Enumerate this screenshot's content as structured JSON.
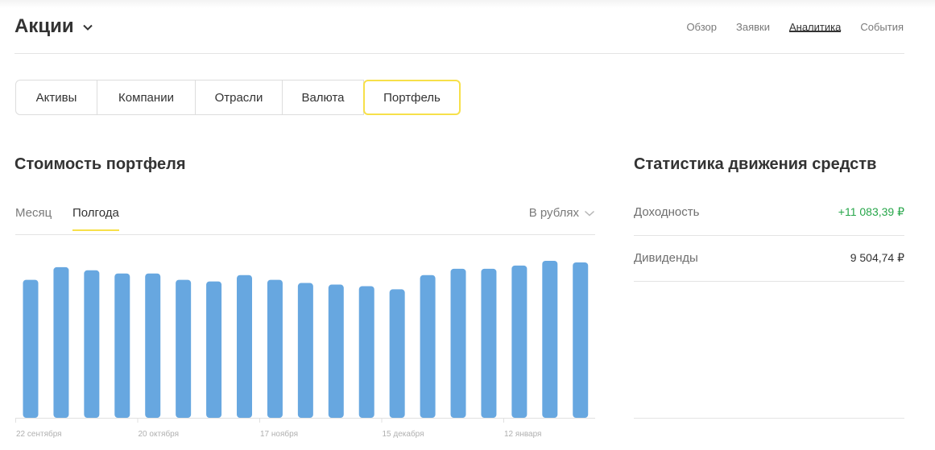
{
  "header": {
    "title": "Акции",
    "nav": [
      "Обзор",
      "Заявки",
      "Аналитика",
      "События"
    ],
    "active_nav": "Аналитика"
  },
  "segments": {
    "items": [
      "Активы",
      "Компании",
      "Отрасли",
      "Валюта",
      "Портфель"
    ],
    "active": "Портфель"
  },
  "portfolio": {
    "title": "Стоимость портфеля",
    "periods": [
      "Месяц",
      "Полгода"
    ],
    "active_period": "Полгода",
    "currency": "В рублях"
  },
  "stats": {
    "title": "Статистика движения средств",
    "rows": [
      {
        "label": "Доходность",
        "value": "+11 083,39 ₽",
        "positive": true
      },
      {
        "label": "Дивиденды",
        "value": "9 504,74 ₽",
        "positive": false
      }
    ]
  },
  "colors": {
    "bar": "#67a7e0",
    "accent": "#f7e04a",
    "positive": "#27a64a"
  },
  "chart_data": {
    "type": "bar",
    "title": "",
    "xlabel": "",
    "ylabel": "",
    "tick_labels": [
      "22 сентября",
      "20 октября",
      "17 ноября",
      "15 декабря",
      "12 января"
    ],
    "values": [
      0.87,
      0.95,
      0.93,
      0.91,
      0.91,
      0.87,
      0.86,
      0.9,
      0.87,
      0.85,
      0.84,
      0.83,
      0.81,
      0.9,
      0.94,
      0.94,
      0.96,
      0.99,
      0.98
    ],
    "ylim": [
      0,
      1
    ],
    "grid": false,
    "legend": "none"
  }
}
